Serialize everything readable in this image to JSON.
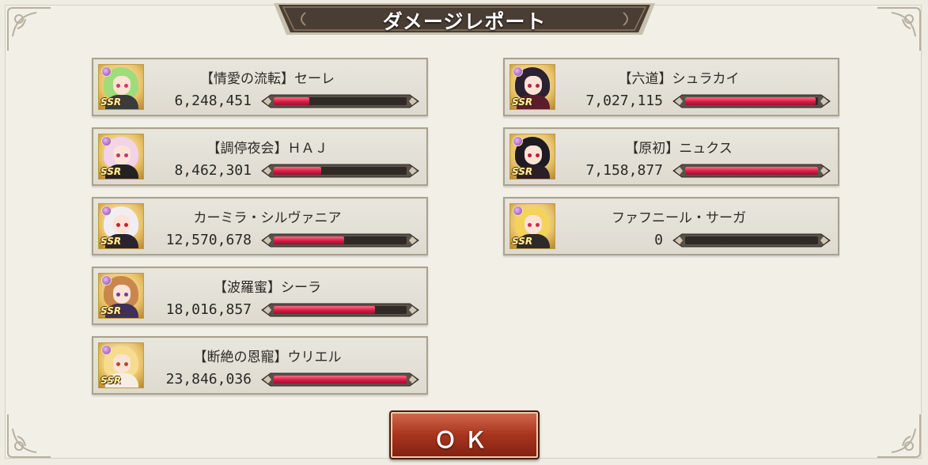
{
  "dialog": {
    "title": "ダメージレポート",
    "ok_label": "ＯＫ"
  },
  "colors": {
    "bar_fill": "#d41c45",
    "bar_track": "#2f2a25",
    "button": "#a8341d",
    "title_plate": "#4a3d33"
  },
  "left_column": [
    {
      "name": "【情愛の流転】セーレ",
      "damage": "6,248,451",
      "ratio": 0.27,
      "rarity": "SSR",
      "hair": "#9fdc7a",
      "eyes": "#d23a6b",
      "outfit": "#3b3b3b"
    },
    {
      "name": "【調停夜会】ＨＡＪ",
      "damage": "8,462,301",
      "ratio": 0.36,
      "rarity": "SSR",
      "hair": "#f2d3e8",
      "eyes": "#b83b7a",
      "outfit": "#222222"
    },
    {
      "name": "カーミラ・シルヴァニア",
      "damage": "12,570,678",
      "ratio": 0.53,
      "rarity": "SSR",
      "hair": "#f1eef2",
      "eyes": "#c3203c",
      "outfit": "#2b2330"
    },
    {
      "name": "【波羅蜜】シーラ",
      "damage": "18,016,857",
      "ratio": 0.76,
      "rarity": "SSR",
      "hair": "#c9874d",
      "eyes": "#7a3a9c",
      "outfit": "#3f2f5c"
    },
    {
      "name": "【断絶の恩寵】ウリエル",
      "damage": "23,846,036",
      "ratio": 1.0,
      "rarity": "SSR",
      "hair": "#f6dc8e",
      "eyes": "#b54a2c",
      "outfit": "#f4efe2"
    }
  ],
  "right_column": [
    {
      "name": "【六道】シュラカイ",
      "damage": "7,027,115",
      "ratio": 0.98,
      "rarity": "SSR",
      "hair": "#2a2230",
      "eyes": "#b02a4a",
      "outfit": "#5a1d2c"
    },
    {
      "name": "【原初】ニュクス",
      "damage": "7,158,877",
      "ratio": 1.0,
      "rarity": "SSR",
      "hair": "#1f1b22",
      "eyes": "#c11e36",
      "outfit": "#2a1f26"
    },
    {
      "name": "ファフニール・サーガ",
      "damage": "0",
      "ratio": 0.0,
      "rarity": "SSR",
      "hair": "#f3d35a",
      "eyes": "#d02c44",
      "outfit": "#2d2a2a"
    }
  ]
}
